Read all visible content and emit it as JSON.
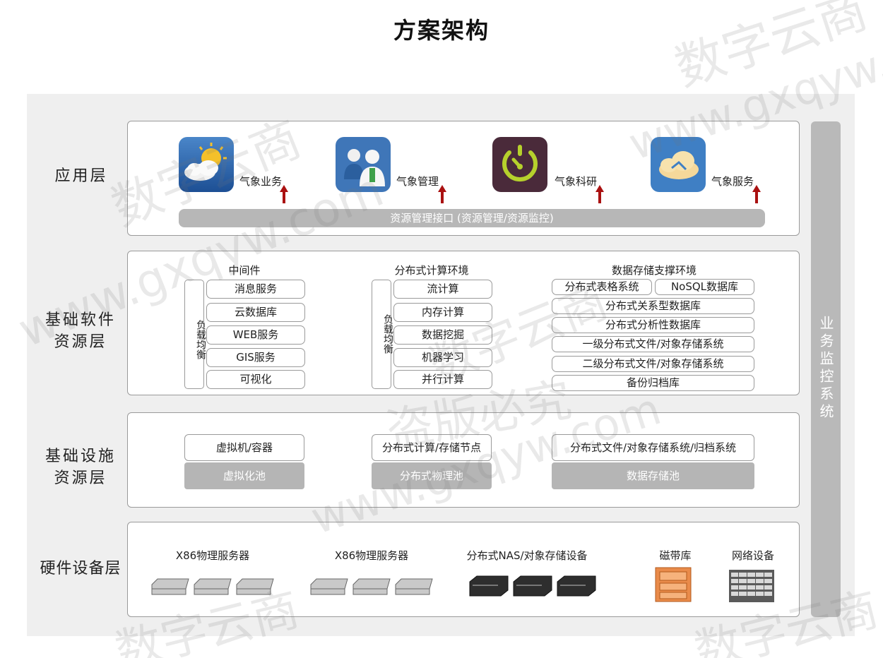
{
  "title": "方案架构",
  "layers": {
    "app": "应用层",
    "software": [
      "基础软件",
      "资源层"
    ],
    "infra": [
      "基础设施",
      "资源层"
    ],
    "hardware": "硬件设备层"
  },
  "side_monitor": "业务监控系统",
  "apps": [
    {
      "label": "气象业务",
      "icon": "weather-sun-cloud-icon"
    },
    {
      "label": "气象管理",
      "icon": "people-management-icon"
    },
    {
      "label": "气象科研",
      "icon": "research-timer-icon"
    },
    {
      "label": "气象服务",
      "icon": "cloud-service-icon"
    }
  ],
  "api_bar": "资源管理接口 (资源管理/资源监控)",
  "middleware": {
    "title": "中间件",
    "lb": "负载均衡",
    "items": [
      "消息服务",
      "云数据库",
      "WEB服务",
      "GIS服务",
      "可视化"
    ]
  },
  "compute": {
    "title": "分布式计算环境",
    "lb": "负载均衡",
    "items": [
      "流计算",
      "内存计算",
      "数据挖掘",
      "机器学习",
      "并行计算"
    ]
  },
  "storage": {
    "title": "数据存储支撑环境",
    "row1": [
      "分布式表格系统",
      "NoSQL数据库"
    ],
    "items": [
      "分布式关系型数据库",
      "分布式分析性数据库",
      "一级分布式文件/对象存储系统",
      "二级分布式文件/对象存储系统",
      "备份归档库"
    ]
  },
  "infra": [
    {
      "node": "虚拟机/容器",
      "pool": "虚拟化池"
    },
    {
      "node": "分布式计算/存储节点",
      "pool": "分布式物理池"
    },
    {
      "node": "分布式文件/对象存储系统/归档系统",
      "pool": "数据存储池"
    }
  ],
  "hardware": [
    {
      "label": "X86物理服务器",
      "icon": "server-icon"
    },
    {
      "label": "X86物理服务器",
      "icon": "server-icon"
    },
    {
      "label": "分布式NAS/对象存储设备",
      "icon": "nas-storage-icon"
    },
    {
      "label": "磁带库",
      "icon": "tape-library-icon"
    },
    {
      "label": "网络设备",
      "icon": "network-switch-icon"
    }
  ],
  "watermark": {
    "site": "数字云商",
    "url": "www.gxqyw.com",
    "notice": "盗版必究"
  },
  "colors": {
    "panel_border": "#9a9a9a",
    "pool_fill": "#b5b5b5",
    "side_bar": "#b9b9b9",
    "arrow": "#a11",
    "outer_bg": "#efefef"
  }
}
